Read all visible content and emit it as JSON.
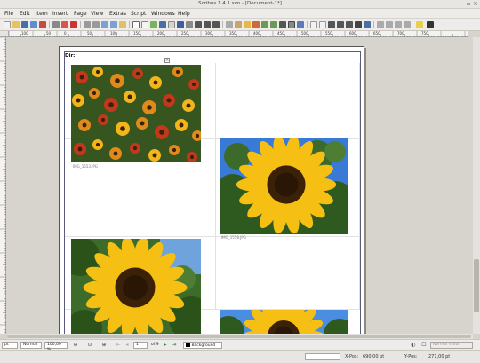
{
  "window": {
    "title": "Scribus 1.4.1.svn - [Document-1*]"
  },
  "menu": [
    "File",
    "Edit",
    "Item",
    "Insert",
    "Page",
    "View",
    "Extras",
    "Script",
    "Windows",
    "Help"
  ],
  "ruler": {
    "labels": [
      "100",
      "50",
      "0",
      "50",
      "100",
      "150",
      "200",
      "250",
      "300",
      "350",
      "400",
      "450",
      "500",
      "550",
      "600",
      "650",
      "700",
      "750"
    ]
  },
  "document": {
    "heading": "Dir:",
    "images": [
      {
        "caption": "IMG_1553.JPG",
        "subject": "flowers"
      },
      {
        "caption": "IMG_1558.JPG",
        "subject": "sunflower"
      },
      {
        "caption": "",
        "subject": "sunflower"
      },
      {
        "caption": "",
        "subject": "sunflower"
      }
    ]
  },
  "status": {
    "unit": "pt",
    "mode": "Normal",
    "zoom": "100,00 %",
    "page_current": "1",
    "page_of": "of 9",
    "layer": "Background",
    "view_mode": "Normal Vision",
    "x_label": "X-Pos:",
    "x_value": "690,00 pt",
    "y_label": "Y-Pos:",
    "y_value": "271,00 pt"
  },
  "colors": {
    "accent": "#4a6fa5",
    "page_border": "#555555",
    "canvas": "#d7d3cd"
  }
}
